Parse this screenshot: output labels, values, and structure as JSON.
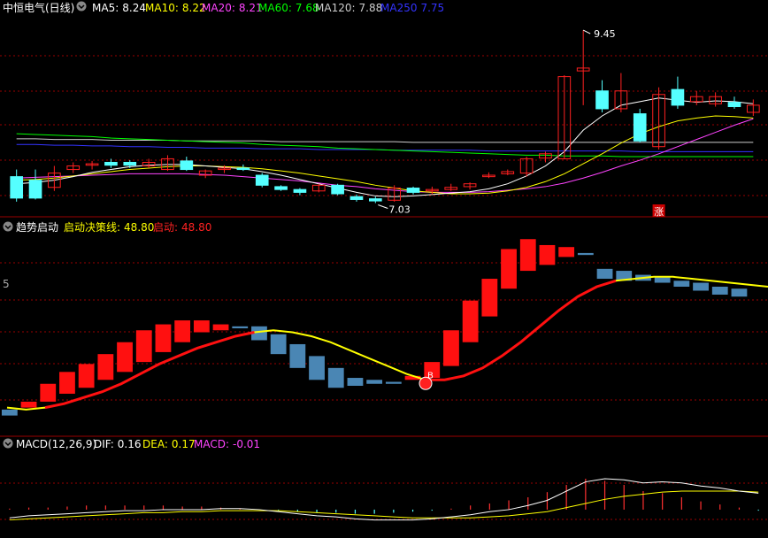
{
  "price_panel": {
    "stock_name": "中恒电气(日线)",
    "indicators": [
      {
        "label": "MA5:",
        "value": "8.24",
        "color": "#ffffff"
      },
      {
        "label": "MA10:",
        "value": "8.22",
        "color": "#ffff00"
      },
      {
        "label": "MA20:",
        "value": "8.21",
        "color": "#ff44ff"
      },
      {
        "label": "MA60:",
        "value": "7.68",
        "color": "#00ff00"
      },
      {
        "label": "MA120:",
        "value": "7.88",
        "color": "#cccccc"
      },
      {
        "label": "MA250",
        "value": "7.75",
        "color": "#3333ff"
      }
    ],
    "high_marker": "9.45",
    "low_marker": "7.03",
    "limit_up_badge": "涨"
  },
  "trend_panel": {
    "title": "趋势启动",
    "indicators": [
      {
        "label": "启动决策线:",
        "value": "48.80",
        "color": "#ffff00"
      },
      {
        "label": "启动:",
        "value": "48.80",
        "color": "#ff2222"
      }
    ],
    "axis_label": "5",
    "signal_label": "B"
  },
  "macd_panel": {
    "title": "MACD(12,26,9)",
    "indicators": [
      {
        "label": "DIF:",
        "value": "0.16",
        "color": "#ffffff"
      },
      {
        "label": "DEA:",
        "value": "0.17",
        "color": "#ffff00"
      },
      {
        "label": "MACD:",
        "value": "-0.01",
        "color": "#ff44ff"
      }
    ]
  },
  "colors": {
    "up": "#ff2020",
    "down": "#55ffff",
    "grid": "#9a0000",
    "ma5": "#ffffff",
    "ma10": "#ffff00",
    "ma20": "#ff44ff",
    "ma60": "#00ff00",
    "ma120": "#cccccc",
    "ma250": "#3333ff",
    "trend_down_bar": "#4a86b4"
  },
  "chart_data": [
    {
      "type": "candlestick",
      "name": "price",
      "ylim": [
        6.9,
        9.6
      ],
      "candles": [
        [
          7.4,
          7.1,
          7.5,
          7.05
        ],
        [
          7.35,
          7.1,
          7.5,
          7.08
        ],
        [
          7.25,
          7.45,
          7.55,
          7.2
        ],
        [
          7.5,
          7.55,
          7.6,
          7.45
        ],
        [
          7.56,
          7.58,
          7.62,
          7.5
        ],
        [
          7.6,
          7.56,
          7.65,
          7.52
        ],
        [
          7.6,
          7.56,
          7.63,
          7.52
        ],
        [
          7.55,
          7.6,
          7.65,
          7.52
        ],
        [
          7.5,
          7.65,
          7.7,
          7.48
        ],
        [
          7.62,
          7.5,
          7.68,
          7.48
        ],
        [
          7.42,
          7.48,
          7.5,
          7.38
        ],
        [
          7.5,
          7.52,
          7.56,
          7.45
        ],
        [
          7.52,
          7.5,
          7.57,
          7.48
        ],
        [
          7.42,
          7.28,
          7.45,
          7.25
        ],
        [
          7.26,
          7.22,
          7.28,
          7.2
        ],
        [
          7.22,
          7.18,
          7.24,
          7.14
        ],
        [
          7.2,
          7.28,
          7.3,
          7.18
        ],
        [
          7.28,
          7.16,
          7.3,
          7.14
        ],
        [
          7.12,
          7.08,
          7.15,
          7.05
        ],
        [
          7.09,
          7.06,
          7.12,
          7.03
        ],
        [
          7.07,
          7.24,
          7.28,
          7.05
        ],
        [
          7.24,
          7.18,
          7.26,
          7.15
        ],
        [
          7.2,
          7.22,
          7.26,
          7.15
        ],
        [
          7.22,
          7.25,
          7.3,
          7.2
        ],
        [
          7.26,
          7.3,
          7.32,
          7.22
        ],
        [
          7.4,
          7.42,
          7.46,
          7.38
        ],
        [
          7.44,
          7.47,
          7.5,
          7.42
        ],
        [
          7.45,
          7.65,
          7.68,
          7.4
        ],
        [
          7.66,
          7.72,
          7.75,
          7.6
        ],
        [
          7.65,
          8.8,
          8.82,
          7.65
        ],
        [
          8.88,
          8.92,
          9.45,
          8.4
        ],
        [
          8.6,
          8.35,
          8.75,
          8.3
        ],
        [
          8.35,
          8.6,
          8.85,
          8.3
        ],
        [
          8.28,
          7.9,
          8.35,
          7.88
        ],
        [
          7.82,
          8.55,
          8.65,
          7.78
        ],
        [
          8.62,
          8.4,
          8.8,
          8.35
        ],
        [
          8.45,
          8.52,
          8.6,
          8.4
        ],
        [
          8.42,
          8.52,
          8.58,
          8.38
        ],
        [
          8.44,
          8.38,
          8.52,
          8.35
        ],
        [
          8.3,
          8.4,
          8.48,
          8.25
        ]
      ],
      "ma5": [
        7.3,
        7.32,
        7.35,
        7.4,
        7.46,
        7.5,
        7.54,
        7.56,
        7.57,
        7.57,
        7.55,
        7.53,
        7.51,
        7.47,
        7.42,
        7.36,
        7.3,
        7.24,
        7.18,
        7.13,
        7.12,
        7.13,
        7.15,
        7.17,
        7.19,
        7.23,
        7.3,
        7.41,
        7.55,
        7.75,
        8.05,
        8.25,
        8.4,
        8.45,
        8.5,
        8.47,
        8.44,
        8.46,
        8.45,
        8.42
      ],
      "ma10": [
        7.35,
        7.36,
        7.38,
        7.41,
        7.44,
        7.47,
        7.5,
        7.52,
        7.54,
        7.55,
        7.55,
        7.54,
        7.53,
        7.51,
        7.48,
        7.45,
        7.41,
        7.37,
        7.33,
        7.28,
        7.24,
        7.2,
        7.18,
        7.16,
        7.16,
        7.17,
        7.2,
        7.25,
        7.33,
        7.44,
        7.58,
        7.72,
        7.87,
        8.0,
        8.1,
        8.18,
        8.22,
        8.25,
        8.24,
        8.22
      ],
      "ma20": [
        7.38,
        7.39,
        7.4,
        7.41,
        7.42,
        7.43,
        7.44,
        7.44,
        7.44,
        7.44,
        7.43,
        7.42,
        7.4,
        7.38,
        7.36,
        7.34,
        7.31,
        7.28,
        7.26,
        7.23,
        7.21,
        7.19,
        7.18,
        7.18,
        7.18,
        7.19,
        7.21,
        7.23,
        7.26,
        7.31,
        7.38,
        7.46,
        7.55,
        7.63,
        7.72,
        7.82,
        7.92,
        8.02,
        8.12,
        8.21
      ],
      "ma60": [
        8.0,
        7.99,
        7.98,
        7.97,
        7.96,
        7.94,
        7.93,
        7.92,
        7.91,
        7.9,
        7.89,
        7.88,
        7.87,
        7.85,
        7.84,
        7.83,
        7.82,
        7.8,
        7.79,
        7.78,
        7.77,
        7.76,
        7.75,
        7.74,
        7.73,
        7.72,
        7.71,
        7.7,
        7.7,
        7.69,
        7.69,
        7.69,
        7.68,
        7.68,
        7.68,
        7.68,
        7.68,
        7.68,
        7.68,
        7.68
      ],
      "ma120": [
        7.93,
        7.93,
        7.92,
        7.92,
        7.92,
        7.91,
        7.91,
        7.91,
        7.91,
        7.9,
        7.9,
        7.9,
        7.9,
        7.9,
        7.89,
        7.89,
        7.89,
        7.89,
        7.89,
        7.89,
        7.89,
        7.88,
        7.88,
        7.88,
        7.88,
        7.88,
        7.88,
        7.88,
        7.88,
        7.88,
        7.88,
        7.88,
        7.88,
        7.88,
        7.88,
        7.88,
        7.88,
        7.88,
        7.88,
        7.88
      ],
      "ma250": [
        7.85,
        7.85,
        7.84,
        7.84,
        7.83,
        7.83,
        7.82,
        7.82,
        7.81,
        7.81,
        7.8,
        7.8,
        7.8,
        7.79,
        7.79,
        7.79,
        7.78,
        7.78,
        7.78,
        7.78,
        7.77,
        7.77,
        7.77,
        7.77,
        7.77,
        7.76,
        7.76,
        7.76,
        7.76,
        7.76,
        7.76,
        7.76,
        7.76,
        7.75,
        7.75,
        7.75,
        7.75,
        7.75,
        7.75,
        7.75
      ]
    },
    {
      "type": "bar",
      "name": "trend-start",
      "ylim": [
        0,
        100
      ],
      "bars": [
        [
          10,
          13,
          "down"
        ],
        [
          14,
          17,
          "up"
        ],
        [
          17,
          26,
          "up"
        ],
        [
          21,
          32,
          "up"
        ],
        [
          24,
          36,
          "up"
        ],
        [
          28,
          41,
          "up"
        ],
        [
          32,
          47,
          "up"
        ],
        [
          37,
          53,
          "up"
        ],
        [
          42,
          56,
          "up"
        ],
        [
          47,
          58,
          "up"
        ],
        [
          52,
          58,
          "up"
        ],
        [
          53,
          56,
          "up"
        ],
        [
          54,
          55,
          "down"
        ],
        [
          48,
          55,
          "down"
        ],
        [
          41,
          51,
          "down"
        ],
        [
          34,
          46,
          "down"
        ],
        [
          28,
          40,
          "down"
        ],
        [
          24,
          34,
          "down"
        ],
        [
          25,
          29,
          "down"
        ],
        [
          26,
          28,
          "down"
        ],
        [
          26,
          27,
          "down"
        ],
        [
          28,
          30,
          "up"
        ],
        [
          29,
          37,
          "up"
        ],
        [
          35,
          53,
          "up"
        ],
        [
          47,
          68,
          "up"
        ],
        [
          60,
          79,
          "up"
        ],
        [
          74,
          94,
          "up"
        ],
        [
          83,
          99,
          "up"
        ],
        [
          86,
          96,
          "up"
        ],
        [
          90,
          95,
          "up"
        ],
        [
          91,
          92,
          "down"
        ],
        [
          79,
          84,
          "down"
        ],
        [
          78,
          83,
          "down"
        ],
        [
          78,
          81,
          "down"
        ],
        [
          77,
          80,
          "down"
        ],
        [
          75,
          78,
          "down"
        ],
        [
          73,
          77,
          "down"
        ],
        [
          71,
          75,
          "down"
        ],
        [
          70,
          74,
          "down"
        ]
      ],
      "decision_line": [
        14,
        13,
        14,
        16,
        19,
        22,
        26,
        31,
        36,
        40,
        44,
        47,
        50,
        52,
        53,
        52,
        50,
        47,
        43,
        39,
        35,
        31,
        28,
        28,
        30,
        34,
        40,
        47,
        55,
        63,
        70,
        75,
        78,
        79,
        80,
        80,
        79,
        78,
        77,
        76,
        75
      ],
      "red_segments": [
        [
          2,
          13
        ],
        [
          22,
          32
        ]
      ],
      "signal_index": 22
    },
    {
      "type": "line",
      "name": "macd",
      "ylim": [
        -0.25,
        0.55
      ],
      "dif": [
        -0.08,
        -0.06,
        -0.05,
        -0.04,
        -0.03,
        -0.02,
        -0.01,
        -0.01,
        0.0,
        0.0,
        0.0,
        0.01,
        0.01,
        0.0,
        -0.02,
        -0.04,
        -0.06,
        -0.07,
        -0.09,
        -0.1,
        -0.1,
        -0.1,
        -0.09,
        -0.07,
        -0.05,
        -0.02,
        0.0,
        0.04,
        0.09,
        0.18,
        0.27,
        0.3,
        0.29,
        0.26,
        0.27,
        0.26,
        0.23,
        0.21,
        0.18,
        0.16
      ],
      "dea": [
        -0.1,
        -0.09,
        -0.08,
        -0.07,
        -0.06,
        -0.05,
        -0.04,
        -0.03,
        -0.03,
        -0.02,
        -0.02,
        -0.01,
        -0.01,
        -0.01,
        -0.01,
        -0.02,
        -0.03,
        -0.04,
        -0.05,
        -0.06,
        -0.07,
        -0.08,
        -0.08,
        -0.08,
        -0.08,
        -0.07,
        -0.06,
        -0.04,
        -0.02,
        0.02,
        0.06,
        0.1,
        0.13,
        0.15,
        0.17,
        0.18,
        0.18,
        0.18,
        0.18,
        0.17
      ],
      "macd": [
        0.01,
        0.02,
        0.02,
        0.03,
        0.04,
        0.04,
        0.04,
        0.04,
        0.04,
        0.03,
        0.03,
        0.02,
        0.01,
        0.0,
        -0.01,
        -0.02,
        -0.03,
        -0.03,
        -0.04,
        -0.04,
        -0.03,
        -0.02,
        -0.01,
        0.01,
        0.04,
        0.06,
        0.09,
        0.12,
        0.17,
        0.24,
        0.3,
        0.28,
        0.24,
        0.18,
        0.16,
        0.12,
        0.08,
        0.05,
        0.02,
        -0.01
      ]
    }
  ]
}
